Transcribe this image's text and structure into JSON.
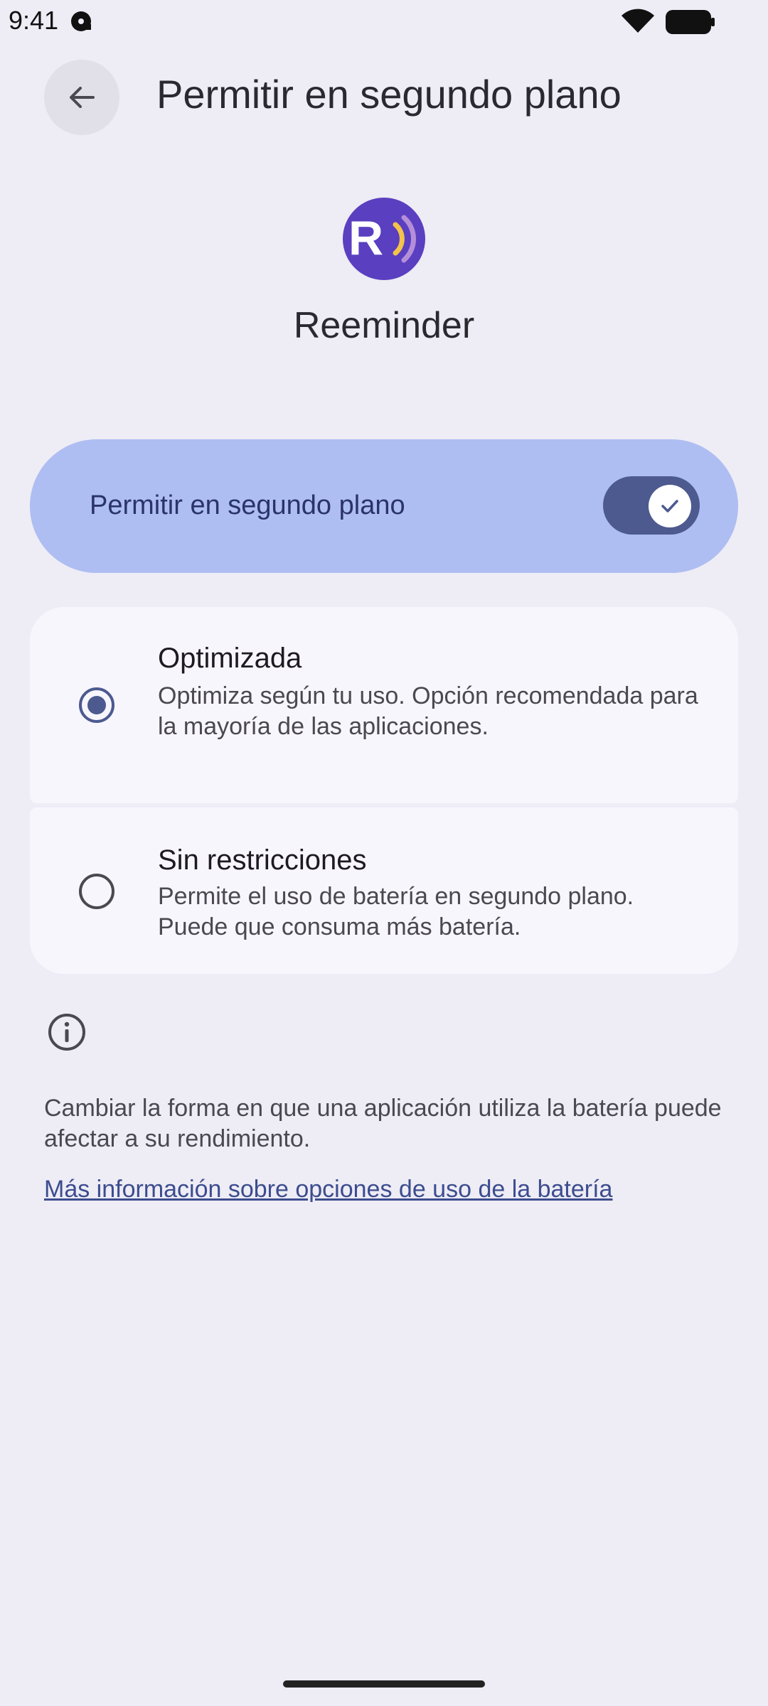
{
  "status_bar": {
    "time": "9:41",
    "icons": [
      "media-disc-icon",
      "wifi-icon",
      "battery-icon"
    ]
  },
  "top_bar": {
    "back_icon": "arrow-back-icon",
    "title": "Permitir en segundo plano"
  },
  "app": {
    "icon": "reeminder-app-icon",
    "name": "Reeminder"
  },
  "background_toggle": {
    "label": "Permitir en segundo plano",
    "enabled": true
  },
  "options": [
    {
      "title": "Optimizada",
      "description": "Optimiza según tu uso. Opción recomendada para la mayoría de las aplicaciones.",
      "selected": true
    },
    {
      "title": "Sin restricciones",
      "description": "Permite el uso de batería en segundo plano. Puede que consuma más batería.",
      "selected": false
    }
  ],
  "info": {
    "icon": "info-icon",
    "text": "Cambiar la forma en que una aplicación utiliza la batería puede afectar a su rendimiento.",
    "link": "Más información sobre opciones de uso de la batería"
  },
  "colors": {
    "background": "#eeecf5",
    "toggle_card": "#aebef2",
    "switch_track": "#4c5a8f",
    "radio_selected": "#4c5a8f",
    "app_icon": "#5a3fc0",
    "link": "#3c4d8e"
  }
}
